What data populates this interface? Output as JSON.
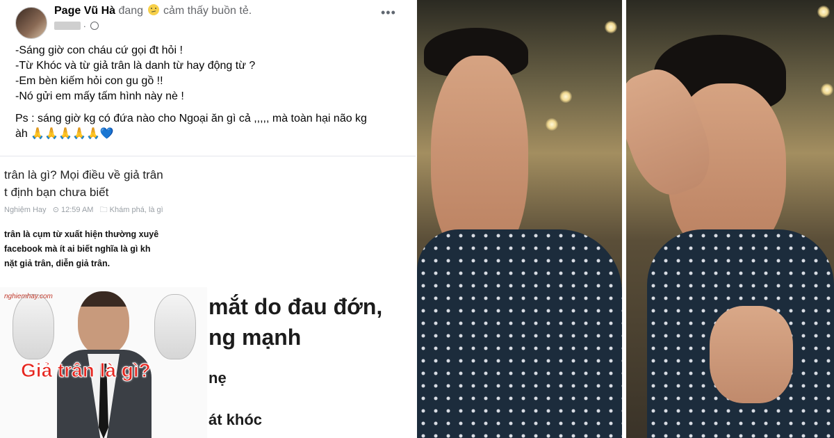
{
  "post": {
    "author": "Page Vũ Hà",
    "feeling_prefix": "đang",
    "feeling_icon": "sad-face-emoji",
    "feeling_text": "cảm thấy buồn tẻ.",
    "privacy_icon": "globe-icon",
    "more_label": "•••",
    "lines": [
      "-Sáng giờ con cháu cứ gọi đt hỏi !",
      "-Từ Khóc và từ giả trân là danh từ hay động từ ?",
      "-Em bèn kiếm hỏi con gu gồ !!",
      "-Nó gửi em mấy tấm hình này nè !"
    ],
    "ps_line1": "Ps : sáng giờ kg có đứa nào cho Ngoại ăn gì cả ,,,,, mà toàn hại não kg",
    "ps_line2": "àh",
    "ps_emojis": "🙏🙏🙏🙏🙏",
    "ps_heart": "💙"
  },
  "article": {
    "title_line1": "trân là gì? Mọi điều về giả trân",
    "title_line2": "t định bạn chưa biết",
    "meta_site": "Nghiệm Hay",
    "meta_time": "⊙ 12:59 AM",
    "meta_category": "🗀 Khám phá, là gì",
    "desc_lines": [
      "trân là cụm từ xuất hiện thường xuyê",
      "facebook mà ít ai biết nghĩa là gì kh",
      "nặt giả trân, diễn giả trân."
    ],
    "thumb_site": "nghiemhay.com",
    "thumb_caption": "Giả trân là gì?",
    "big_lines": [
      "mắt do đau đớn,",
      "ng mạnh",
      "nẹ",
      "át khóc"
    ]
  },
  "colors": {
    "text_primary": "#050505",
    "text_secondary": "#65676b",
    "caption_red": "#e6261f",
    "shirt_navy": "#1c2c3c"
  }
}
